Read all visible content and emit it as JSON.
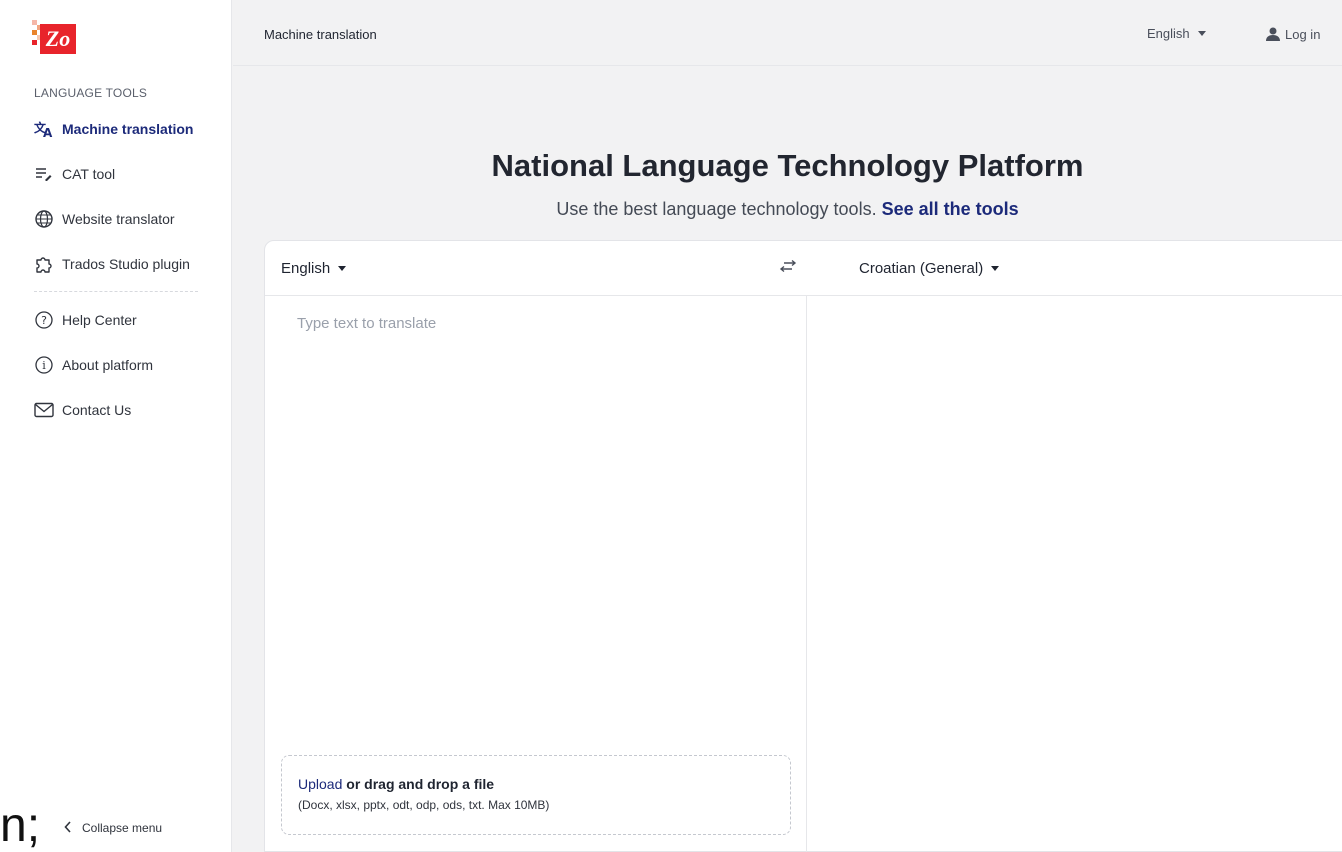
{
  "sidebar": {
    "section_label": "LANGUAGE TOOLS",
    "items": [
      {
        "label": "Machine translation",
        "icon": "translate-icon",
        "active": true
      },
      {
        "label": "CAT tool",
        "icon": "cat-tool-icon",
        "active": false
      },
      {
        "label": "Website translator",
        "icon": "globe-icon",
        "active": false
      },
      {
        "label": "Trados Studio plugin",
        "icon": "puzzle-icon",
        "active": false
      },
      {
        "label": "Help Center",
        "icon": "help-circle-icon",
        "active": false
      },
      {
        "label": "About platform",
        "icon": "info-circle-icon",
        "active": false
      },
      {
        "label": "Contact Us",
        "icon": "mail-icon",
        "active": false
      }
    ],
    "collapse_label": "Collapse menu",
    "edge_glyph": "n;"
  },
  "topbar": {
    "breadcrumb": "Machine translation",
    "ui_language": "English",
    "login_label": "Log in"
  },
  "hero": {
    "title": "National Language Technology Platform",
    "subtitle": "Use the best language technology tools.",
    "link_label": "See all the tools"
  },
  "translator": {
    "source_language": "English",
    "target_language": "Croatian (General)",
    "source_placeholder": "Type text to translate",
    "source_value": "",
    "upload_link": "Upload",
    "upload_text": " or drag and drop a file",
    "upload_hint": "(Docx, xlsx, pptx, odt, odp, ods, txt. Max 10MB)"
  },
  "colors": {
    "brand_red": "#e8242b",
    "accent_navy": "#1c2a7a",
    "background": "#f2f2f3"
  }
}
